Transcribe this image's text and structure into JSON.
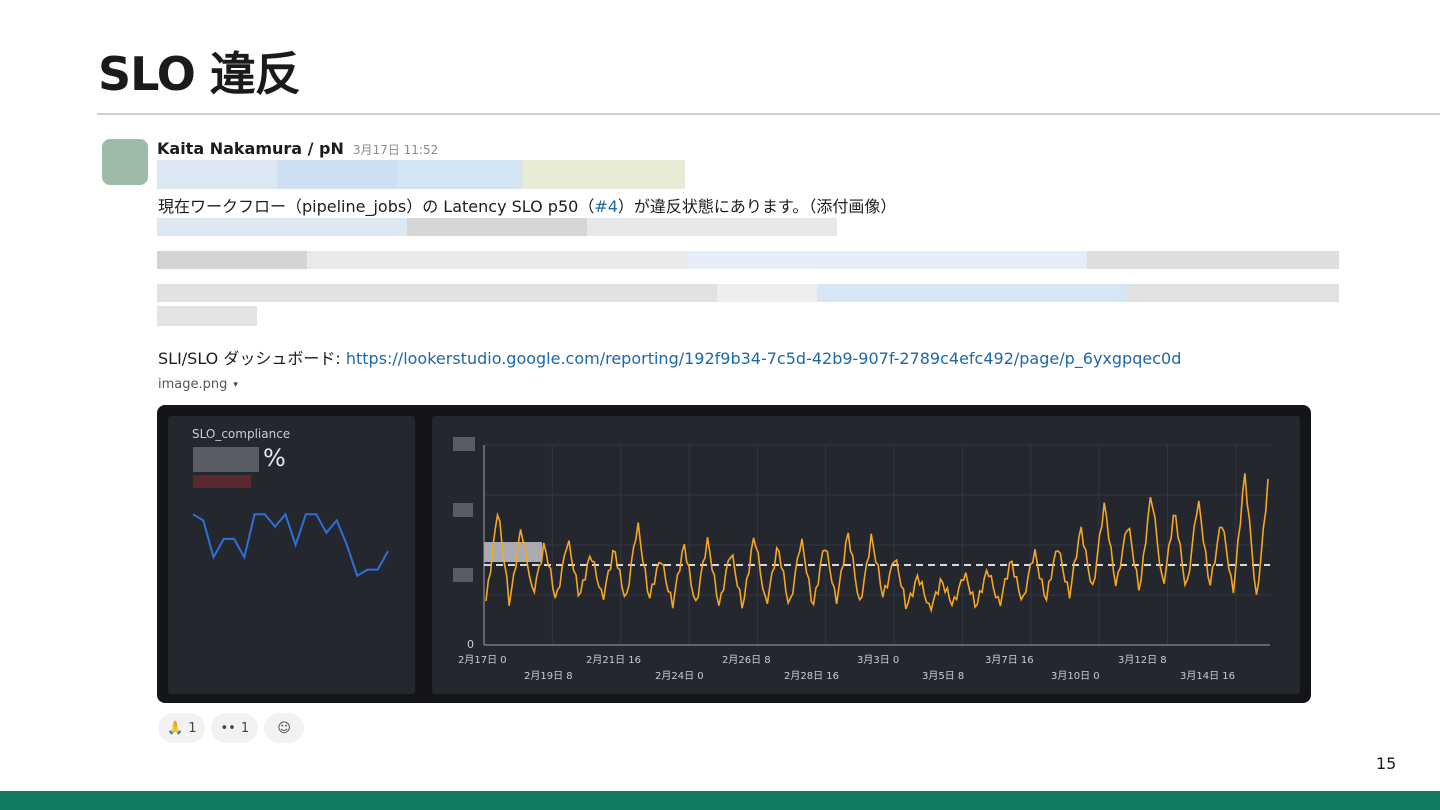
{
  "slide": {
    "title": "SLO 違反",
    "page_number": "15"
  },
  "message": {
    "author": "Kaita Nakamura / pN",
    "timestamp": "3月17日 11:52",
    "line1_prefix": "現在ワークフロー（pipeline_jobs）の Latency SLO p50（",
    "line1_link": "#4",
    "line1_suffix": "）が違反状態にあります。（添付画像）",
    "dashboard_label": "SLI/SLO ダッシュボード: ",
    "dashboard_url": "https://lookerstudio.google.com/reporting/192f9b34-7c5d-42b9-907f-2789c4efc492/page/p_6yxgpqec0d"
  },
  "attachment": {
    "filename": "image.png",
    "caret_icon": "▾"
  },
  "dashboard": {
    "compliance_label": "SLO_compliance",
    "compliance_unit": "%",
    "colors": {
      "background": "#141518",
      "panel": "#25272e",
      "latency": "#f5a623",
      "compliance": "#2f6fd6",
      "threshold": "#d9d9d9"
    },
    "y_zero_label": "0",
    "x_ticks_upper": [
      "2月17日 0",
      "2月21日 16",
      "2月26日 8",
      "3月3日 0",
      "3月7日 16",
      "3月12日 8"
    ],
    "x_ticks_lower": [
      "2月19日 8",
      "2月24日 0",
      "2月28日 16",
      "3月5日 8",
      "3月10日 0",
      "3月14日 16"
    ]
  },
  "chart_data": [
    {
      "type": "line",
      "title": "SLO_compliance",
      "series": [
        {
          "values": [
            96,
            95,
            89,
            92,
            92,
            89,
            96,
            96,
            94,
            96,
            91,
            96,
            96,
            93,
            95,
            91,
            86,
            87,
            87,
            90
          ]
        }
      ]
    },
    {
      "type": "line",
      "title": "",
      "x": [
        "2月17日 0",
        "2月19日 8",
        "2月21日 16",
        "2月24日 0",
        "2月26日 8",
        "2月28日 16",
        "3月3日 0",
        "3月5日 8",
        "3月7日 16",
        "3月10日 0",
        "3月12日 8",
        "3月14日 16"
      ],
      "threshold": 0.4,
      "ylim": [
        0,
        1
      ],
      "series": [
        {
          "values": [
            0.22,
            0.68,
            0.2,
            0.6,
            0.24,
            0.52,
            0.2,
            0.55,
            0.22,
            0.48,
            0.21,
            0.5,
            0.2,
            0.62,
            0.22,
            0.44,
            0.2,
            0.5,
            0.2,
            0.52,
            0.2,
            0.46,
            0.2,
            0.54,
            0.21,
            0.48,
            0.2,
            0.52,
            0.2,
            0.5,
            0.22,
            0.56,
            0.2,
            0.54,
            0.24,
            0.45,
            0.18,
            0.36,
            0.16,
            0.34,
            0.18,
            0.38,
            0.17,
            0.4,
            0.18,
            0.44,
            0.2,
            0.48,
            0.22,
            0.5,
            0.25,
            0.58,
            0.28,
            0.7,
            0.3,
            0.6,
            0.28,
            0.75,
            0.3,
            0.66,
            0.28,
            0.72,
            0.3,
            0.62,
            0.26,
            0.86,
            0.22,
            0.82
          ]
        }
      ]
    }
  ]
}
